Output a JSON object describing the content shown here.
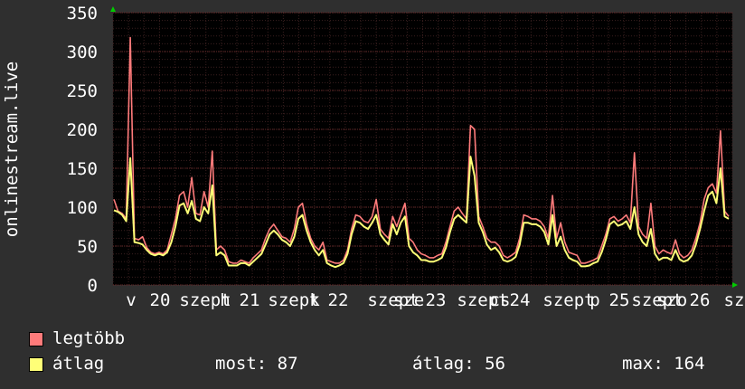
{
  "chart_data": {
    "type": "line",
    "ylabel": "onlinestream.live",
    "ylim": [
      0,
      350
    ],
    "yticks": [
      0,
      50,
      100,
      150,
      200,
      250,
      300,
      350
    ],
    "xticks": [
      "v",
      "20",
      "szept",
      "h",
      "21",
      "szept",
      "k",
      "22",
      "szept",
      "sze",
      "23",
      "szept",
      "cs",
      "24",
      "szept",
      "p",
      "25",
      "szept",
      "szo",
      "26",
      "sz"
    ],
    "grid": true,
    "series": [
      {
        "name": "legtöbb",
        "color": "#ff7b7b",
        "values": [
          110,
          95,
          92,
          85,
          318,
          60,
          58,
          62,
          48,
          42,
          40,
          42,
          40,
          45,
          65,
          85,
          115,
          120,
          100,
          138,
          92,
          90,
          120,
          100,
          172,
          45,
          50,
          45,
          30,
          28,
          28,
          32,
          30,
          28,
          35,
          40,
          45,
          60,
          72,
          78,
          70,
          62,
          60,
          55,
          72,
          100,
          105,
          78,
          60,
          50,
          45,
          55,
          32,
          30,
          28,
          28,
          32,
          45,
          72,
          90,
          88,
          82,
          80,
          88,
          110,
          72,
          65,
          60,
          88,
          75,
          90,
          105,
          60,
          55,
          45,
          40,
          38,
          35,
          35,
          38,
          40,
          55,
          75,
          95,
          100,
          92,
          85,
          205,
          200,
          88,
          75,
          60,
          55,
          55,
          50,
          38,
          35,
          38,
          42,
          60,
          90,
          88,
          85,
          85,
          82,
          75,
          60,
          115,
          60,
          80,
          55,
          42,
          40,
          38,
          28,
          28,
          30,
          32,
          35,
          50,
          65,
          85,
          88,
          82,
          85,
          90,
          80,
          170,
          75,
          65,
          60,
          105,
          50,
          40,
          45,
          42,
          40,
          58,
          40,
          35,
          38,
          45,
          60,
          80,
          110,
          125,
          130,
          118,
          198,
          95,
          88
        ]
      },
      {
        "name": "átlag",
        "color": "#ffff77",
        "values": [
          96,
          94,
          90,
          82,
          163,
          55,
          54,
          52,
          45,
          40,
          38,
          40,
          38,
          42,
          55,
          75,
          102,
          105,
          92,
          108,
          85,
          82,
          100,
          92,
          128,
          38,
          42,
          38,
          25,
          25,
          25,
          28,
          28,
          25,
          30,
          35,
          40,
          52,
          65,
          70,
          65,
          58,
          55,
          50,
          62,
          85,
          90,
          70,
          55,
          45,
          38,
          45,
          28,
          25,
          23,
          25,
          28,
          40,
          65,
          82,
          80,
          75,
          72,
          80,
          90,
          65,
          58,
          52,
          78,
          65,
          80,
          88,
          50,
          42,
          38,
          32,
          32,
          30,
          30,
          32,
          35,
          48,
          68,
          85,
          90,
          85,
          80,
          165,
          140,
          80,
          68,
          52,
          45,
          48,
          42,
          32,
          30,
          32,
          36,
          52,
          80,
          80,
          78,
          78,
          75,
          68,
          52,
          90,
          50,
          62,
          45,
          35,
          32,
          30,
          24,
          24,
          25,
          28,
          30,
          42,
          58,
          78,
          82,
          76,
          78,
          82,
          72,
          100,
          65,
          55,
          50,
          72,
          40,
          32,
          35,
          35,
          32,
          45,
          33,
          30,
          32,
          38,
          52,
          72,
          95,
          115,
          120,
          105,
          150,
          88,
          85
        ]
      }
    ],
    "legend": [
      "legtöbb",
      "átlag"
    ]
  },
  "stats": {
    "now_label": "most:",
    "now_value": "87",
    "avg_label": "átlag:",
    "avg_value": "56",
    "max_label": "max:",
    "max_value": "164"
  },
  "colors": {
    "background": "#2f2f2f",
    "plot_bg": "#000000",
    "grid": "#5a2a2a",
    "axis_arrow": "#00cc00"
  }
}
